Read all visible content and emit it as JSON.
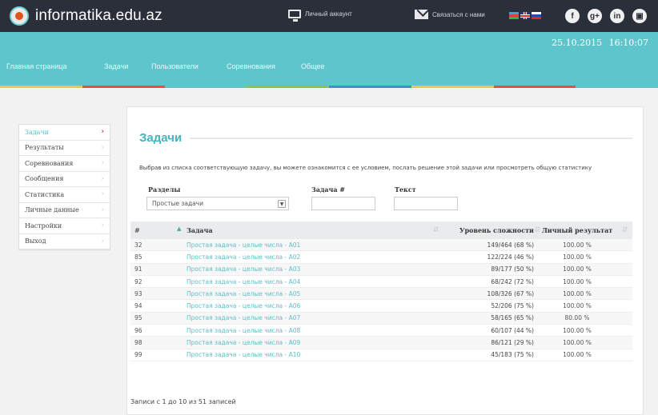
{
  "header": {
    "site_name": "informatika.edu.az",
    "account_label": "Личный аккаунт",
    "contact_label": "Связаться с нами",
    "social": [
      "f",
      "g+",
      "in",
      "▣"
    ]
  },
  "nav": {
    "items": [
      "Главная страница",
      "Задачи",
      "Пользователи",
      "Соревнования",
      "Общее"
    ],
    "date": "25.10.2015",
    "time": "16:10:07"
  },
  "sidebar": {
    "items": [
      "Задачи",
      "Результаты",
      "Соревнования",
      "Сообщения",
      "Статистика",
      "Личные данные",
      "Настройки",
      "Выход"
    ]
  },
  "main": {
    "title": "Задачи",
    "description": "Выбрав из списка соответствующую задачу, вы можете ознакомится с ее условием, послать решение этой задачи или просмотреть общую статистику",
    "filters": {
      "section_label": "Разделы",
      "section_value": "Простые задачи",
      "task_label": "Задача #",
      "text_label": "Текст"
    },
    "table": {
      "headers": [
        "#",
        "Задача",
        "Уровень сложности",
        "Личный результат"
      ],
      "rows": [
        {
          "id": "32",
          "task": "Простая задача - целые числа - A01",
          "level": "149/464 (68 %)",
          "result": "100.00 %"
        },
        {
          "id": "85",
          "task": "Простая задача - целые числа - A02",
          "level": "122/224 (46 %)",
          "result": "100.00 %"
        },
        {
          "id": "91",
          "task": "Простая задача - целые числа - A03",
          "level": "89/177 (50 %)",
          "result": "100.00 %"
        },
        {
          "id": "92",
          "task": "Простая задача - целые числа - A04",
          "level": "68/242 (72 %)",
          "result": "100.00 %"
        },
        {
          "id": "93",
          "task": "Простая задача - целые числа - A05",
          "level": "108/326 (67 %)",
          "result": "100.00 %"
        },
        {
          "id": "94",
          "task": "Простая задача - целые числа - A06",
          "level": "52/206 (75 %)",
          "result": "100.00 %"
        },
        {
          "id": "95",
          "task": "Простая задача - целые числа - A07",
          "level": "58/165 (65 %)",
          "result": "80.00 %"
        },
        {
          "id": "96",
          "task": "Простая задача - целые числа - A08",
          "level": "60/107 (44 %)",
          "result": "100.00 %"
        },
        {
          "id": "98",
          "task": "Простая задача - целые числа - A09",
          "level": "86/121 (29 %)",
          "result": "100.00 %"
        },
        {
          "id": "99",
          "task": "Простая задача - целые числа - A10",
          "level": "45/183 (75 %)",
          "result": "100.00 %"
        }
      ]
    },
    "footer": "Записи с 1 до 10 из 51 записей"
  },
  "colors": {
    "topbar": "#2b2f3a",
    "nav": "#5cc6cc",
    "accent": "#45b3bd",
    "active_arrow": "#d6282d",
    "stripe": [
      "#f2c53d",
      "#e8503a",
      "#5cc6cc",
      "#8bc34a",
      "#3a8fd6",
      "#f2c53d",
      "#e8503a",
      "#5cc6cc"
    ]
  }
}
